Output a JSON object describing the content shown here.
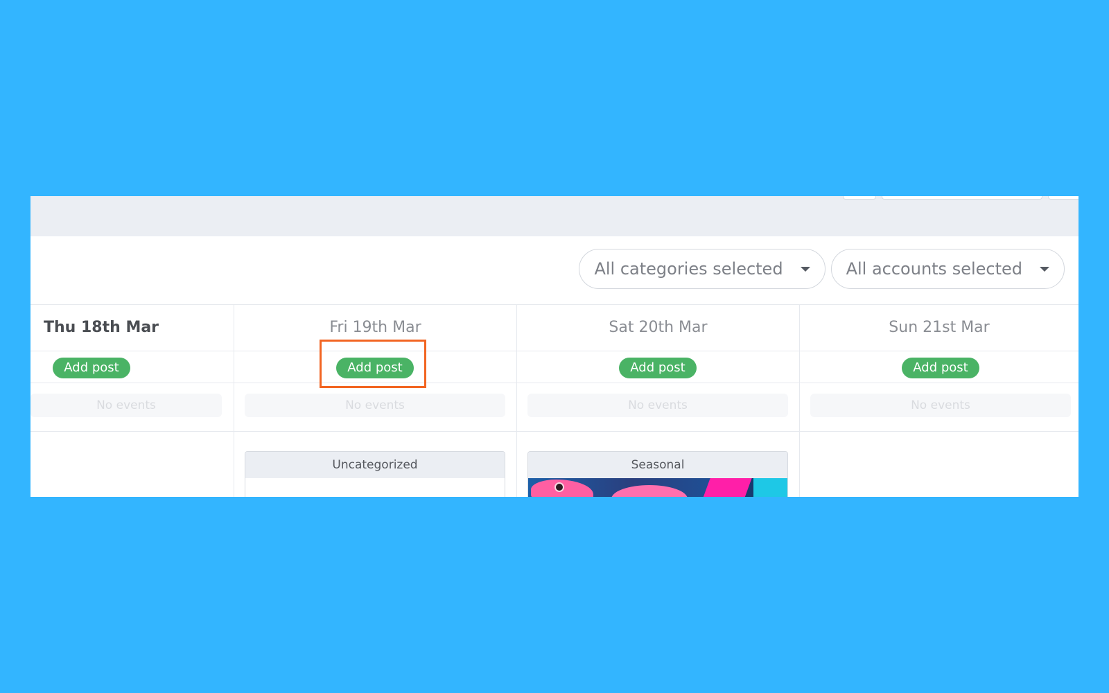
{
  "filters": {
    "categories_label": "All categories selected",
    "accounts_label": "All accounts selected"
  },
  "days": [
    {
      "title": "Thu 18th Mar",
      "add_label": "Add post",
      "no_events": "No events"
    },
    {
      "title": "Fri 19th Mar",
      "add_label": "Add post",
      "no_events": "No events"
    },
    {
      "title": "Sat 20th Mar",
      "add_label": "Add post",
      "no_events": "No events"
    },
    {
      "title": "Sun 21st Mar",
      "add_label": "Add post",
      "no_events": "No events"
    }
  ],
  "cards": [
    {
      "category": "Uncategorized"
    },
    {
      "category": "Seasonal"
    }
  ],
  "colors": {
    "background": "#33b5ff",
    "add_button": "#4ab365",
    "highlight": "#f26522"
  }
}
